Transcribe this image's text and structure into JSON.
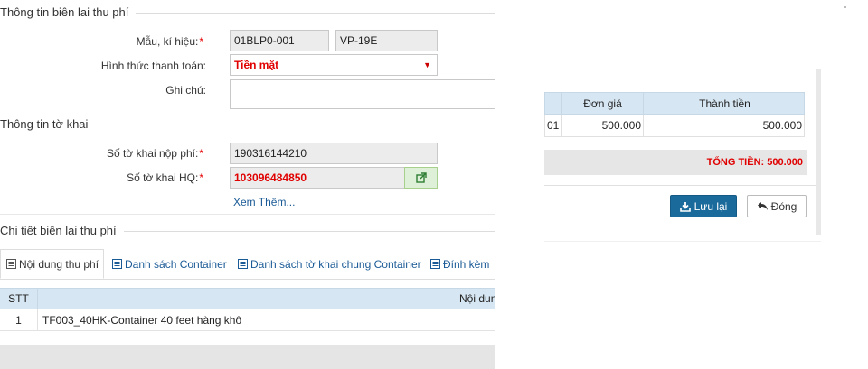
{
  "sections": {
    "receipt_info": "Thông tin biên lai thu phí",
    "declaration_info": "Thông tin tờ khai",
    "receipt_detail": "Chi tiết biên lai thu phí"
  },
  "form": {
    "template_label": "Mẫu, kí hiệu:",
    "template_value": "01BLP0-001",
    "symbol_value": "VP-19E",
    "payment_label": "Hình thức thanh toán:",
    "payment_value": "Tiền mặt",
    "note_label": "Ghi chú:",
    "note_value": "",
    "fee_decl_label": "Số tờ khai nộp phí:",
    "fee_decl_value": "190316144210",
    "hq_decl_label": "Số tờ khai HQ:",
    "hq_decl_value": "103096484850",
    "see_more": "Xem Thêm...",
    "required_mark": "*"
  },
  "tabs": [
    {
      "label": "Nội dung thu phí",
      "icon": "list-icon"
    },
    {
      "label": "Danh sách Container",
      "icon": "list-icon"
    },
    {
      "label": "Danh sách tờ khai chung Container",
      "icon": "list-icon"
    },
    {
      "label": "Đính kèm",
      "icon": "list-icon"
    }
  ],
  "detail_table": {
    "columns": [
      "STT",
      "Nội dun"
    ],
    "rows": [
      {
        "stt": "1",
        "content": "TF003_40HK-Container 40 feet hàng khô"
      }
    ]
  },
  "price_table": {
    "columns": [
      "Đơn giá",
      "Thành tiền"
    ],
    "rows": [
      {
        "partial": "01",
        "unit_price": "500.000",
        "amount": "500.000"
      }
    ]
  },
  "total": "TỔNG TIỀN: 500.000",
  "buttons": {
    "save": "Lưu lại",
    "close": "Đóng"
  },
  "colors": {
    "accent": "#1b6a9c",
    "required": "#e60000",
    "table_header": "#d6e6f2"
  }
}
